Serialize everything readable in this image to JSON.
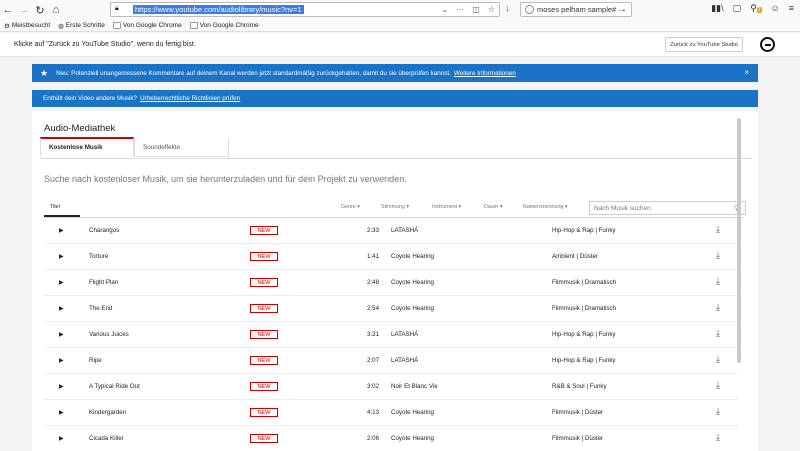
{
  "browser": {
    "url": "https://www.youtube.com/audiolibrary/music?nv=1",
    "search_value": "moses pelham sample#",
    "notification_count": "1"
  },
  "bookmarks": [
    "Meistbesucht",
    "Erste Schritte",
    "Von Google Chrome",
    "Von Google Chrome"
  ],
  "header": {
    "back_hint": "Klicke auf \"Zurück zu YouTube Studio\", wenn du fertig bist.",
    "back_button": "Zurück zu YouTube Studio"
  },
  "banner1": {
    "text": "Neu: Potenziell unangemessene Kommentare auf deinem Kanal werden jetzt standardmäßig zurückgehalten, damit du sie überprüfen kannst.",
    "link": "Weitere Informationen"
  },
  "banner2": {
    "text": "Enthält dein Video andere Musik?",
    "link": "Urheberrechtliche Richtlinien prüfen"
  },
  "main": {
    "title": "Audio-Mediathek",
    "tabs": [
      "Kostenlose Musik",
      "Soundeffekte"
    ],
    "lead": "Suche nach kostenloser Musik, um sie herunterzuladen und für dein Projekt zu verwenden.",
    "columns": {
      "titel": "Titel",
      "genre": "Genre",
      "stimmung": "Stimmung",
      "instrument": "Instrument",
      "dauer": "Dauer",
      "namensnennung": "Namensnennung"
    },
    "search_placeholder": "Nach Musik suchen",
    "new_label": "NEW",
    "rows": [
      {
        "title": "Charangos",
        "duration": "2:33",
        "artist": "LATASHÁ",
        "genre": "Hip-Hop & Rap | Funky"
      },
      {
        "title": "Torture",
        "duration": "1:41",
        "artist": "Coyote Hearing",
        "genre": "Ambient | Düster"
      },
      {
        "title": "Flight Plan",
        "duration": "2:48",
        "artist": "Coyote Hearing",
        "genre": "Filmmusik | Dramatisch"
      },
      {
        "title": "The End",
        "duration": "2:54",
        "artist": "Coyote Hearing",
        "genre": "Filmmusik | Dramatisch"
      },
      {
        "title": "Various Juices",
        "duration": "3:21",
        "artist": "LATASHÁ",
        "genre": "Hip-Hop & Rap | Funky"
      },
      {
        "title": "Ripe",
        "duration": "2:07",
        "artist": "LATASHÁ",
        "genre": "Hip-Hop & Rap | Funky"
      },
      {
        "title": "A Typical Ride Out",
        "duration": "3:02",
        "artist": "Noir Et Blanc Vie",
        "genre": "R&B & Soul | Funky"
      },
      {
        "title": "Kindergarden",
        "duration": "4:13",
        "artist": "Coyote Hearing",
        "genre": "Filmmusik | Düster"
      },
      {
        "title": "Cicada Killer",
        "duration": "2:06",
        "artist": "Coyote Hearing",
        "genre": "Filmmusik | Düster"
      }
    ]
  }
}
